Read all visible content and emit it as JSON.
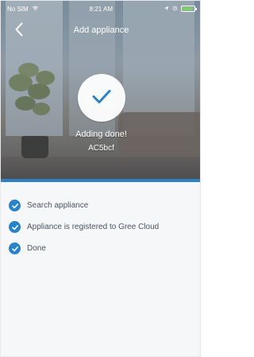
{
  "status_bar": {
    "carrier": "No SIM",
    "wifi_icon": "wifi-icon",
    "time": "8:21 AM",
    "right_icons": [
      "location-icon",
      "alarm-icon",
      "battery-icon"
    ]
  },
  "header": {
    "title": "Add appliance",
    "back_icon": "chevron-left-icon"
  },
  "hero": {
    "success_text": "Adding done!",
    "device_id": "AC5bcf"
  },
  "steps": [
    {
      "label": "Search appliance",
      "icon": "check-circle-icon"
    },
    {
      "label": "Appliance is registered to Gree Cloud",
      "icon": "check-circle-icon"
    },
    {
      "label": "Done",
      "icon": "check-circle-icon"
    }
  ],
  "colors": {
    "accent": "#2a83c9",
    "background": "#f6f7f9"
  }
}
